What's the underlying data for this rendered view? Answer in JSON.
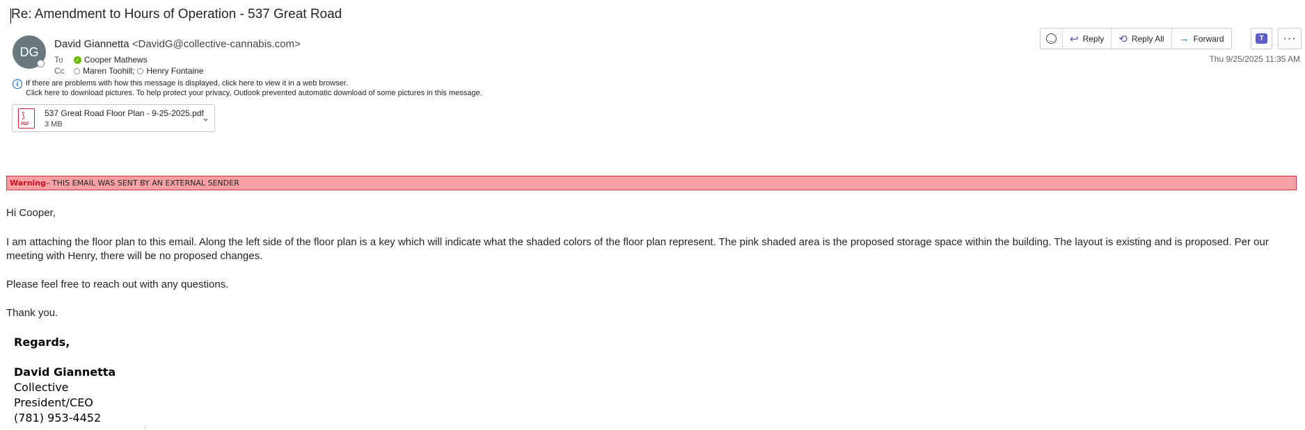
{
  "email": {
    "subject": "Re: Amendment to Hours of Operation - 537 Great Road",
    "avatar_initials": "DG",
    "sender_name": "David Giannetta",
    "sender_email": "<DavidG@collective-cannabis.com>",
    "to_label": "To",
    "to": [
      "Cooper Mathews"
    ],
    "cc_label": "Cc",
    "cc": [
      "Maren Toohill;",
      "Henry Fontaine"
    ],
    "date": "Thu 9/25/2025 11:35 AM",
    "info_line1": "If there are problems with how this message is displayed, click here to view it in a web browser.",
    "info_line2": "Click here to download pictures. To help protect your privacy, Outlook prevented automatic download of some pictures in this message."
  },
  "attachment": {
    "name": "537 Great Road Floor Plan - 9-25-2025.pdf",
    "size": "3 MB",
    "icon_tag": "PDF"
  },
  "actions": {
    "reply": "Reply",
    "reply_all": "Reply All",
    "forward": "Forward"
  },
  "warning": {
    "label": "Warning",
    "text": " – THIS EMAIL WAS SENT BY AN EXTERNAL SENDER"
  },
  "body": {
    "greeting": "Hi Cooper,",
    "para1": "I am attaching the floor plan to this email.  Along the left side of the floor plan is a key which will indicate what the shaded colors of the floor plan represent.  The pink shaded area is the proposed storage space within the building.  The layout is existing and is proposed.  Per our meeting with Henry, there will be no proposed changes.",
    "para2": "Please feel free to reach out with any questions.",
    "para3": "Thank you."
  },
  "signature": {
    "regards": "Regards,",
    "name": "David Giannetta",
    "company": "Collective",
    "title": "President/CEO",
    "phone": "(781) 953-4452"
  },
  "icons": {
    "emoji": "emoji-icon",
    "reply": "reply-icon",
    "reply_all": "reply-all-icon",
    "forward": "forward-icon",
    "teams": "teams-icon",
    "more": "more-icon"
  },
  "colors": {
    "avatar": "#69797e",
    "warning_bg": "#f8a1a4",
    "warning_border": "#d13438",
    "accent_purple": "#6b47a6",
    "accent_blue": "#0f6cbd"
  }
}
